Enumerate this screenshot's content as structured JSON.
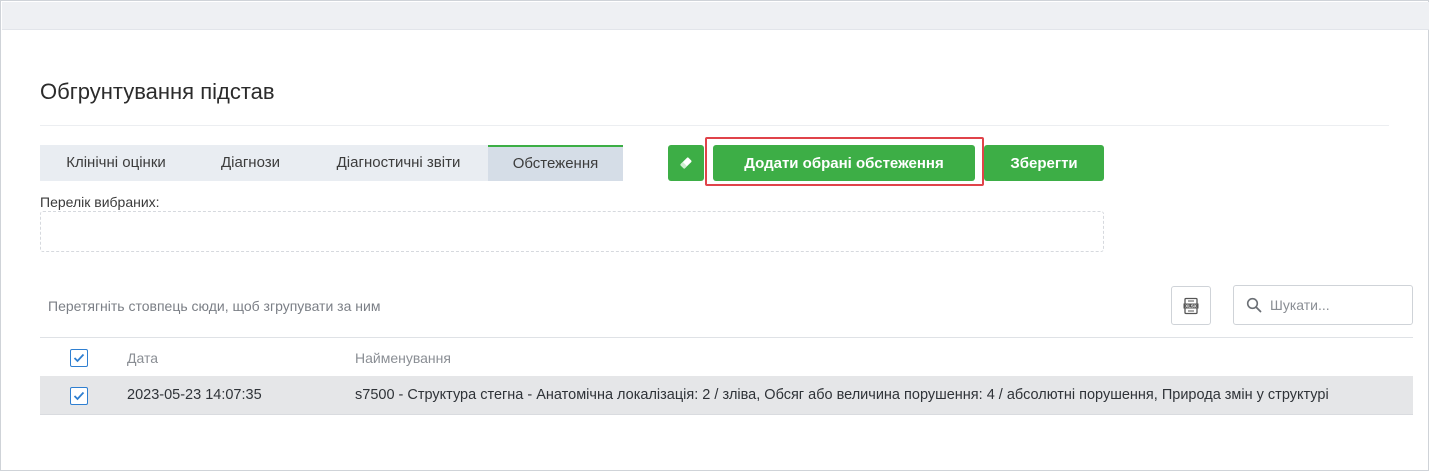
{
  "page": {
    "title": "Обгрунтування підстав"
  },
  "tabs": [
    {
      "label": "Клінічні оцінки",
      "active": false
    },
    {
      "label": "Діагнози",
      "active": false
    },
    {
      "label": "Діагностичні звіти",
      "active": false
    },
    {
      "label": "Обстеження",
      "active": true
    }
  ],
  "toolbar": {
    "eraser_icon": "eraser-icon",
    "add_label": "Додати обрані обстеження",
    "save_label": "Зберегти"
  },
  "selected": {
    "label": "Перелік вибраних:"
  },
  "grid": {
    "group_hint": "Перетягніть стовпець сюди, щоб згрупувати за ним",
    "export_icon": "xlsx-export-icon",
    "search_placeholder": "Шукати...",
    "columns": [
      "Дата",
      "Найменування"
    ],
    "rows": [
      {
        "checked": true,
        "date": "2023-05-23 14:07:35",
        "name": "s7500 - Структура стегна - Анатомічна локалізація: 2 / зліва, Обсяг або величина порушення: 4 / абсолютні порушення, Природа змін у структурі"
      }
    ]
  },
  "colors": {
    "accent_green": "#3dae46",
    "highlight_red": "#e0434a",
    "checkbox_blue": "#2f7fd1"
  }
}
